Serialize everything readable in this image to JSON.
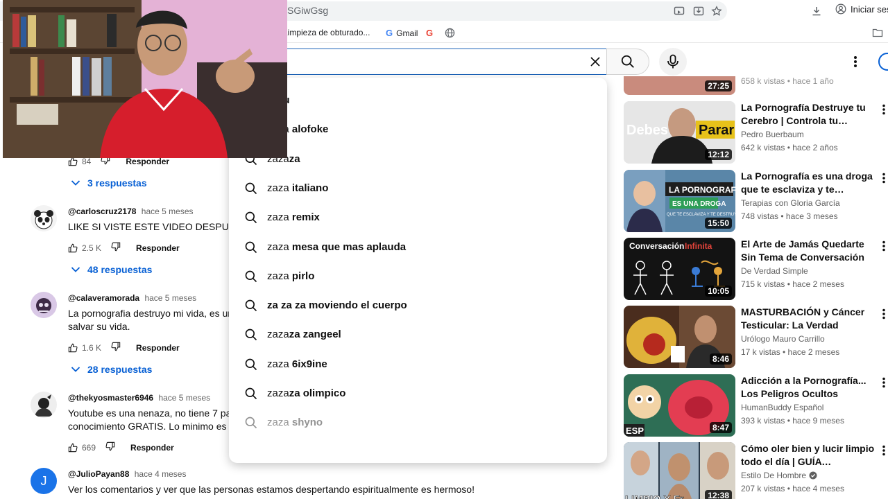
{
  "browser": {
    "url_fragment": "SGiwGsg",
    "signin_label": "Iniciar sesi",
    "bookmarks": [
      {
        "label": "Limpieza de obturado..."
      },
      {
        "label": "Gmail"
      }
    ]
  },
  "search": {
    "query": ""
  },
  "comments": {
    "top_actions": {
      "likes": "84",
      "reply_label": "Responder"
    },
    "top_replies": "3 respuestas",
    "items": [
      {
        "author": "@carloscruz2178",
        "time": "hace 5 meses",
        "text_lines": [
          "LIKE SI VISTE ESTE VIDEO DESPUÉS D"
        ],
        "likes": "2.5 K",
        "reply_label": "Responder",
        "replies": "48 respuestas"
      },
      {
        "author": "@calaveramorada",
        "time": "hace 5 meses",
        "text_lines": [
          "La pornografia destruyo mi vida, es una",
          "salvar su vida."
        ],
        "likes": "1.6 K",
        "reply_label": "Responder",
        "replies": "28 respuestas"
      },
      {
        "author": "@thekyosmaster6946",
        "time": "hace 5 meses",
        "text_lines": [
          "Youtube es una nenaza, no tiene 7 pala",
          "conocimiento GRATIS. Lo minimo es qu"
        ],
        "likes": "669",
        "reply_label": "Responder"
      },
      {
        "author": "@JulioPayan88",
        "time": "hace 4 meses",
        "avatar_letter": "J",
        "text_lines": [
          "Ver los comentarios y ver que las personas estamos despertando espiritualmente es hermoso!"
        ]
      }
    ]
  },
  "suggestions": [
    {
      "prefix": "",
      "suffix": "peru"
    },
    {
      "prefix": "zaza ",
      "suffix": "alofoke"
    },
    {
      "prefix": "zaza",
      "suffix": "za"
    },
    {
      "prefix": "zaza ",
      "suffix": "italiano"
    },
    {
      "prefix": "zaza ",
      "suffix": "remix"
    },
    {
      "prefix": "zaza ",
      "suffix": "mesa que mas aplauda"
    },
    {
      "prefix": "zaza ",
      "suffix": "pirlo"
    },
    {
      "prefix": "",
      "suffix": "za za za moviendo el cuerpo"
    },
    {
      "prefix": "zaza",
      "suffix": "za zangeel"
    },
    {
      "prefix": "zaza ",
      "suffix": "6ix9ine"
    },
    {
      "prefix": "zaza",
      "suffix": "za olimpico"
    },
    {
      "prefix": "zaza ",
      "suffix": "shyno"
    }
  ],
  "recommendations": [
    {
      "title": "",
      "channel": "",
      "meta": "658 k vistas • hace 1 año",
      "duration": "27:25",
      "thumb_color": "#c98b7d"
    },
    {
      "title": "La Pornografía Destruye tu Cerebro | Controla tu Adicción",
      "channel": "Pedro Buerbaum",
      "meta": "642 k vistas • hace 2 años",
      "duration": "12:12",
      "thumb_text": [
        "Debes",
        "Parar"
      ]
    },
    {
      "title": "La Pornografía es una droga que te esclaviza y te destruye...",
      "channel": "Terapias con Gloria García",
      "meta": "748 vistas • hace 3 meses",
      "duration": "15:50",
      "thumb_text": [
        "LA PORNOGRAFIA",
        "ES UNA DROGA",
        "QUE TE ESCLAVIZA Y TE DESTRUYE"
      ]
    },
    {
      "title": "El Arte de Jamás Quedarte Sin Tema de Conversación",
      "channel": "De Verdad Simple",
      "meta": "715 k vistas • hace 2 meses",
      "duration": "10:05",
      "thumb_text": [
        "Conversación",
        "Infinita"
      ]
    },
    {
      "title": "MASTURBACIÓN y Cáncer Testicular: La Verdad",
      "channel": "Urólogo Mauro Carrillo",
      "meta": "17 k vistas • hace 2 meses",
      "duration": "8:46"
    },
    {
      "title": "Adicción a la Pornografía... Los Peligros Ocultos",
      "channel": "HumanBuddy Español",
      "meta": "393 k vistas • hace 9 meses",
      "duration": "8:47",
      "thumb_text": [
        "ESP"
      ]
    },
    {
      "title": "Cómo oler bien y lucir limpio todo el día | GUÍA DEFINITIVA ...",
      "channel": "Estilo De Hombre",
      "verified": true,
      "meta": "207 k vistas • hace 4 meses",
      "duration": "12:38",
      "thumb_text": [
        "LIMPIO Y Fr"
      ]
    }
  ],
  "colors": {
    "link_blue": "#065fd4",
    "text_primary": "#0f0f0f",
    "text_secondary": "#606060"
  }
}
